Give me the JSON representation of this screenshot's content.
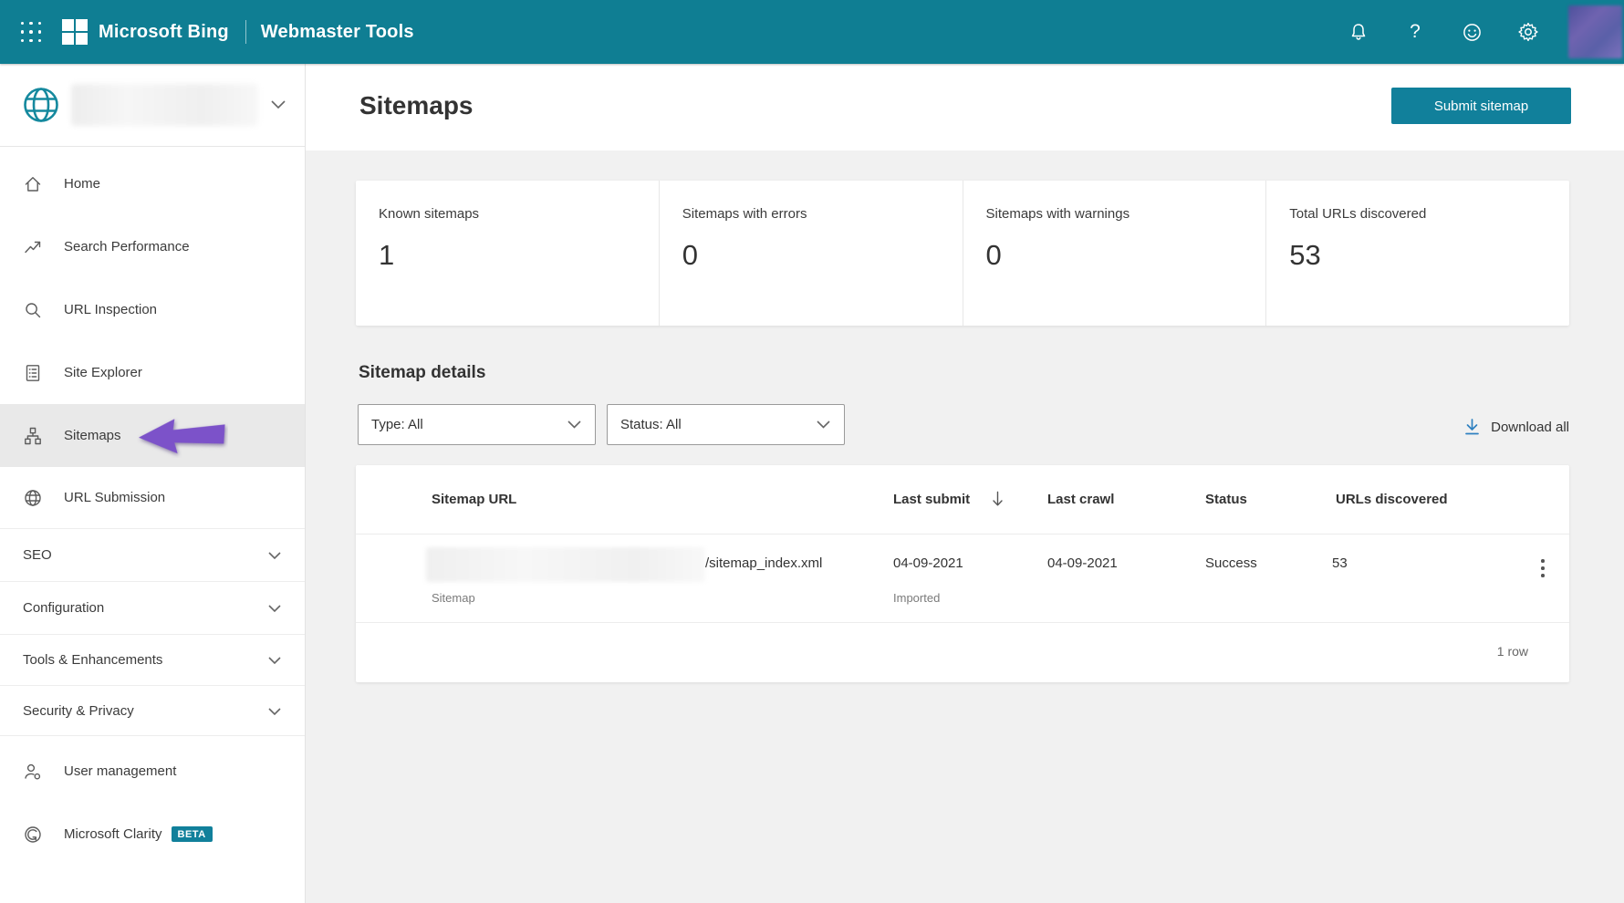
{
  "topbar": {
    "brand_primary": "Microsoft Bing",
    "brand_secondary": "Webmaster Tools"
  },
  "sidebar": {
    "items": [
      {
        "label": "Home"
      },
      {
        "label": "Search Performance"
      },
      {
        "label": "URL Inspection"
      },
      {
        "label": "Site Explorer"
      },
      {
        "label": "Sitemaps",
        "selected": true
      },
      {
        "label": "URL Submission"
      }
    ],
    "groups": [
      {
        "label": "SEO"
      },
      {
        "label": "Configuration"
      },
      {
        "label": "Tools & Enhancements"
      },
      {
        "label": "Security & Privacy"
      }
    ],
    "footer_items": [
      {
        "label": "User management"
      },
      {
        "label": "Microsoft Clarity",
        "badge": "BETA"
      }
    ]
  },
  "page": {
    "title": "Sitemaps",
    "submit_button": "Submit sitemap"
  },
  "stats": {
    "cards": [
      {
        "label": "Known sitemaps",
        "value": "1"
      },
      {
        "label": "Sitemaps with errors",
        "value": "0"
      },
      {
        "label": "Sitemaps with warnings",
        "value": "0"
      },
      {
        "label": "Total URLs discovered",
        "value": "53"
      }
    ]
  },
  "details": {
    "heading": "Sitemap details",
    "type_filter": "Type: All",
    "status_filter": "Status: All",
    "download_label": "Download all"
  },
  "table": {
    "headers": [
      "Sitemap URL",
      "Last submit",
      "Last crawl",
      "Status",
      "URLs discovered"
    ],
    "row": {
      "url_suffix": "/sitemap_index.xml",
      "url_type": "Sitemap",
      "last_submit": "04-09-2021",
      "last_submit_note": "Imported",
      "last_crawl": "04-09-2021",
      "status": "Success",
      "urls_discovered": "53"
    },
    "footer": "1 row"
  },
  "colors": {
    "topbar": "#0F7E93",
    "button": "#11809B",
    "badge": "#11809B",
    "arrow": "#7C52C9",
    "download_icon": "#2E80C0"
  }
}
